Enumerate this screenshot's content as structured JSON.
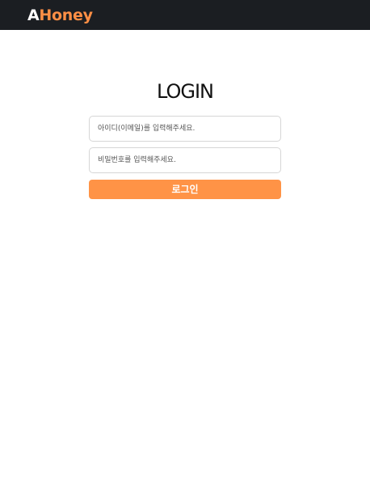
{
  "header": {
    "logo_first": "A",
    "logo_rest": "Honey"
  },
  "login": {
    "title": "LOGIN",
    "id_placeholder": "아이디(이메일)를 입력해주세요.",
    "pw_placeholder": "비밀번호를 입력해주세요.",
    "button_label": "로그인"
  },
  "colors": {
    "header_bg": "#1b1e22",
    "brand_accent": "#ff8f45",
    "button_bg": "#ff9346"
  }
}
